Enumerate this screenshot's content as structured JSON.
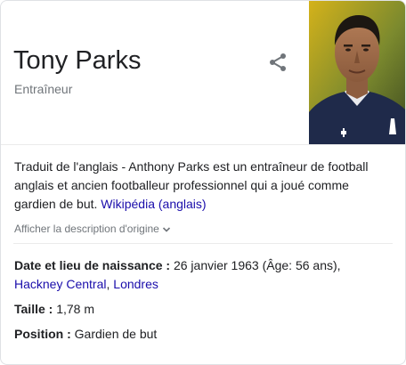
{
  "entity": {
    "name": "Tony Parks",
    "type": "Entraîneur"
  },
  "icons": {
    "share": "share-icon",
    "expand": "chevron-down-icon"
  },
  "description": {
    "text": "Traduit de l'anglais - Anthony Parks est un entraîneur de football anglais et ancien footballeur professionnel qui a joué comme gardien de but.",
    "source_link": "Wikipédia (anglais)",
    "show_original": "Afficher la description d'origine"
  },
  "facts": {
    "birth": {
      "label": "Date et lieu de naissance :",
      "value": "26 janvier 1963 (Âge: 56 ans),",
      "place_1": "Hackney Central",
      "separator": ",",
      "place_2": "Londres"
    },
    "height": {
      "label": "Taille :",
      "value": "1,78 m"
    },
    "position": {
      "label": "Position :",
      "value": "Gardien de but"
    }
  },
  "colors": {
    "link": "#1a0dab",
    "secondary_text": "#70757a",
    "primary_text": "#202124"
  }
}
